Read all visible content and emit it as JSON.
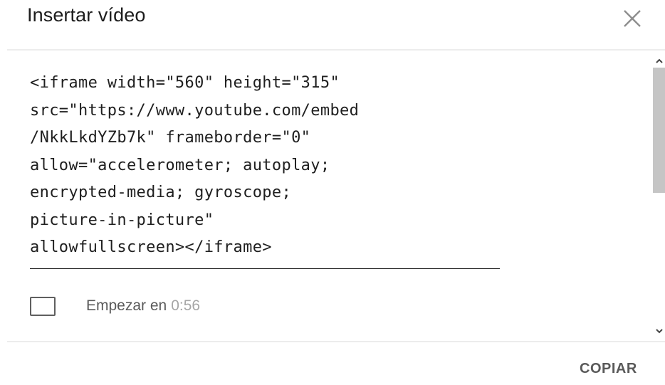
{
  "dialog": {
    "title": "Insertar vídeo",
    "close_icon": "close-icon",
    "embed_code": "<iframe width=\"560\" height=\"315\"\nsrc=\"https://www.youtube.com/embed\n/NkkLkdYZb7k\" frameborder=\"0\"\nallow=\"accelerometer; autoplay;\nencrypted-media; gyroscope;\npicture-in-picture\"\nallowfullscreen></iframe>",
    "start_at": {
      "label": "Empezar en",
      "time": "0:56",
      "checked": false
    },
    "copy_label": "COPIAR"
  },
  "colors": {
    "title_text": "#1c1c1c",
    "secondary_text": "#5a5a5a",
    "muted_text": "#a6a6a6",
    "divider": "#ececec",
    "scroll_thumb": "#c5c5c5"
  }
}
